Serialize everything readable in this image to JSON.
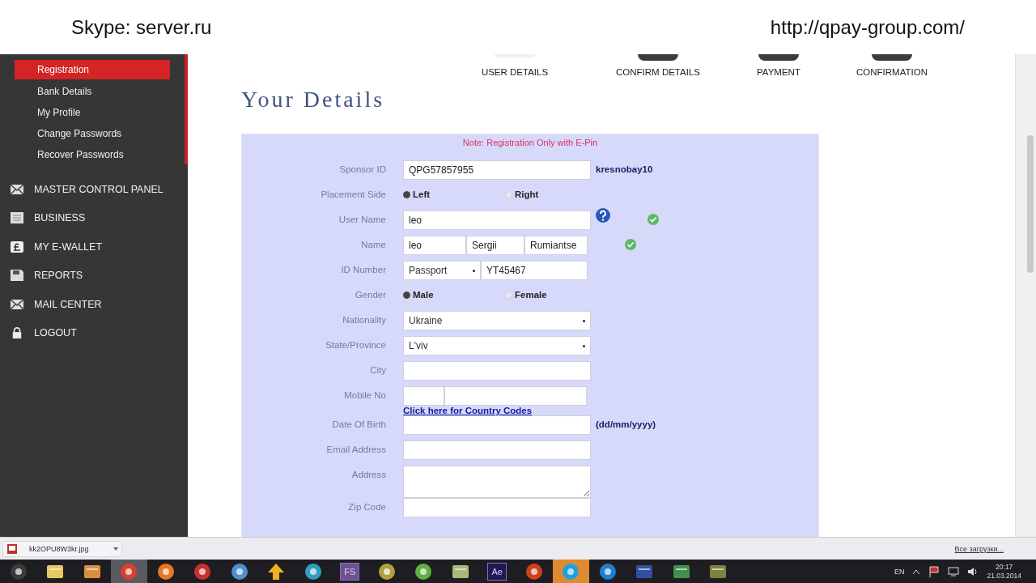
{
  "caption": {
    "left": "Skype: server.ru",
    "right": "http://qpay-group.com/"
  },
  "sidebar": {
    "submenu": [
      {
        "label": "Registration",
        "selected": true
      },
      {
        "label": "Bank Details",
        "selected": false
      },
      {
        "label": "My Profile",
        "selected": false
      },
      {
        "label": "Change Passwords",
        "selected": false
      },
      {
        "label": "Recover Passwords",
        "selected": false
      }
    ],
    "menu": [
      {
        "label": "MASTER CONTROL PANEL",
        "kind": "mail"
      },
      {
        "label": "BUSINESS",
        "kind": "book"
      },
      {
        "label": "MY E-WALLET",
        "kind": "wallet"
      },
      {
        "label": "REPORTS",
        "kind": "reports"
      },
      {
        "label": "MAIL CENTER",
        "kind": "mail"
      },
      {
        "label": "LOGOUT",
        "kind": "lock"
      }
    ]
  },
  "steps": [
    {
      "label": "USER DETAILS",
      "selected": true
    },
    {
      "label": "CONFIRM DETAILS",
      "selected": false
    },
    {
      "label": "PAYMENT",
      "selected": false
    },
    {
      "label": "CONFIRMATION",
      "selected": false
    }
  ],
  "heading": "Your Details",
  "form": {
    "note": "Note: Registration Only with E-Pin",
    "rows": [
      {
        "label": "Sponsor ID",
        "kind": "text",
        "value": "QPG57857955",
        "aside": "kresnobay10"
      },
      {
        "label": "Placement Side",
        "kind": "radio",
        "options": [
          {
            "label": "Left",
            "selected": true
          },
          {
            "label": "Right",
            "selected": false
          }
        ]
      },
      {
        "label": "User Name",
        "kind": "text",
        "value": "leo",
        "help": true,
        "valid": true
      },
      {
        "label": "Name",
        "kind": "multi",
        "values": [
          "leo",
          "Sergii",
          "Rumiantse"
        ],
        "valid": true
      },
      {
        "label": "ID Number",
        "kind": "id",
        "select": "Passport",
        "value": "YT45467"
      },
      {
        "label": "Gender",
        "kind": "radio",
        "options": [
          {
            "label": "Male",
            "selected": true
          },
          {
            "label": "Female",
            "selected": false
          }
        ]
      },
      {
        "label": "Nationality",
        "kind": "select",
        "value": "Ukraine"
      },
      {
        "label": "State/Province",
        "kind": "select",
        "value": "L'viv"
      },
      {
        "label": "City",
        "kind": "text"
      },
      {
        "label": "Mobile No",
        "kind": "phone",
        "link": "Click here for Country Codes"
      },
      {
        "label": "Date Of Birth",
        "kind": "text",
        "aside": "(dd/mm/yyyy)"
      },
      {
        "label": "Email Address",
        "kind": "text"
      },
      {
        "label": "Address",
        "kind": "textarea"
      },
      {
        "label": "Zip Code",
        "kind": "text"
      }
    ]
  },
  "download_bar": {
    "file": "kk2OPU8W3kr.jpg",
    "all_downloads": "Все загрузки..."
  },
  "taskbar": {
    "apps": [
      {
        "kind": "start",
        "selected": false
      },
      {
        "kind": "folder",
        "selected": false
      },
      {
        "kind": "media",
        "selected": false
      },
      {
        "kind": "chrome",
        "selected": true
      },
      {
        "kind": "firefox",
        "selected": false
      },
      {
        "kind": "ccleaner",
        "selected": false
      },
      {
        "kind": "network",
        "selected": false
      },
      {
        "kind": "upload",
        "selected": false
      },
      {
        "kind": "browser",
        "selected": false
      },
      {
        "kind": "fs",
        "label": "FS",
        "selected": false
      },
      {
        "kind": "coin",
        "selected": false
      },
      {
        "kind": "torrent",
        "selected": false
      },
      {
        "kind": "notes",
        "selected": false
      },
      {
        "kind": "ae",
        "label": "Ae",
        "selected": false
      },
      {
        "kind": "ext",
        "selected": false
      },
      {
        "kind": "skype",
        "selected": true
      },
      {
        "kind": "bapp",
        "selected": false
      },
      {
        "kind": "word",
        "selected": false
      },
      {
        "kind": "excel",
        "selected": false
      },
      {
        "kind": "tool",
        "selected": false
      }
    ],
    "language": "EN",
    "time": "20:17",
    "date": "21.03.2014"
  }
}
